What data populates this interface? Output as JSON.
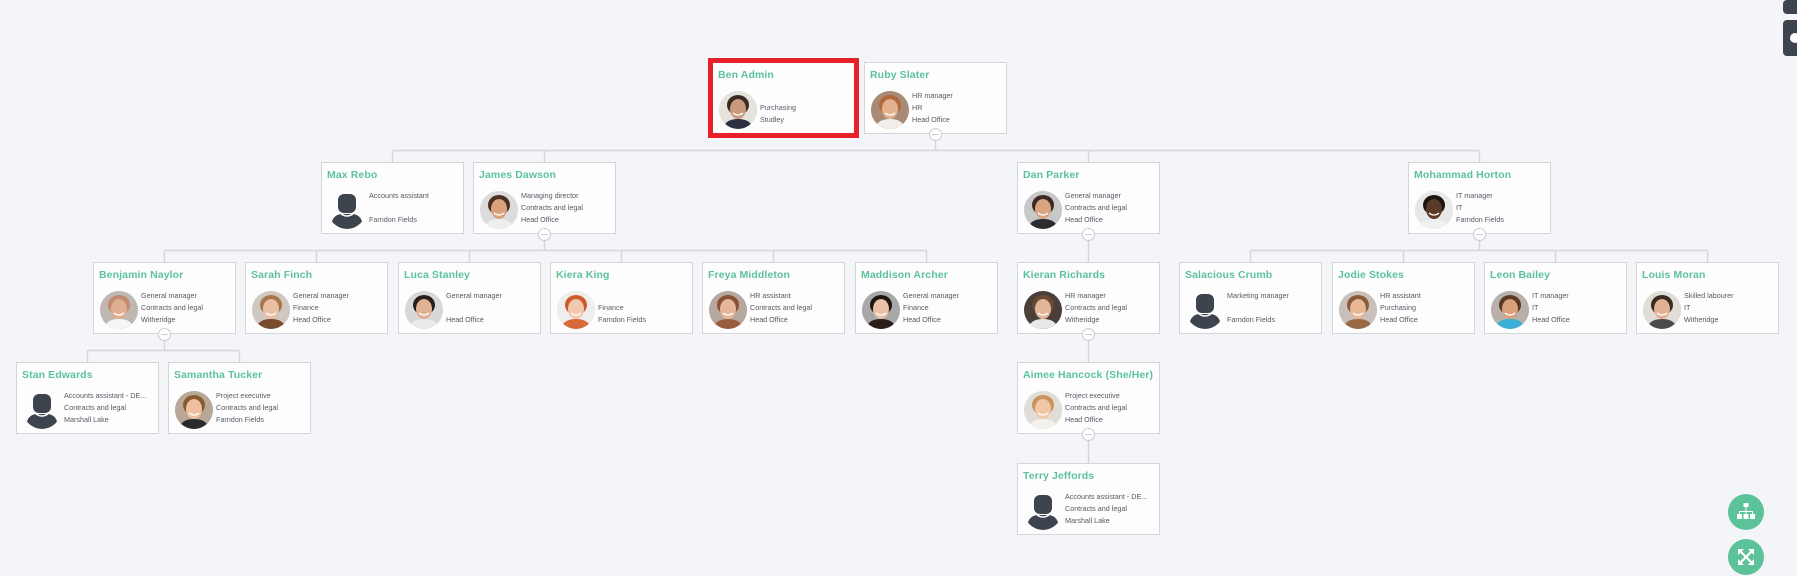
{
  "theme": {
    "accent": "#5cc29a",
    "selection": "#e8202a",
    "background": "#f4f5f9",
    "dark_tab": "#3e444d"
  },
  "nodes": [
    {
      "id": "ben",
      "name": "Ben Admin",
      "lines": [
        "",
        "Purchasing",
        "Studley"
      ],
      "avatar": "photo-bearded-man",
      "selected": true,
      "row": 0
    },
    {
      "id": "ruby",
      "name": "Ruby Slater",
      "lines": [
        "HR manager",
        "HR",
        "Head Office"
      ],
      "avatar": "photo-woman-smiling",
      "row": 0,
      "toggle": true
    },
    {
      "id": "max",
      "name": "Max Rebo",
      "lines": [
        "Accounts assistant",
        "",
        "Farndon Fields"
      ],
      "avatar": "silhouette",
      "row": 1
    },
    {
      "id": "james",
      "name": "James Dawson",
      "lines": [
        "Managing director",
        "Contracts and legal",
        "Head Office"
      ],
      "avatar": "photo-man-smiling",
      "row": 1,
      "toggle": true
    },
    {
      "id": "dan",
      "name": "Dan Parker",
      "lines": [
        "General manager",
        "Contracts and legal",
        "Head Office"
      ],
      "avatar": "photo-man-suit",
      "row": 1,
      "toggle": true
    },
    {
      "id": "mohammad",
      "name": "Mohammad Horton",
      "lines": [
        "IT manager",
        "IT",
        "Farndon Fields"
      ],
      "avatar": "photo-man-glasses",
      "row": 1,
      "toggle": true
    },
    {
      "id": "benjamin",
      "name": "Benjamin Naylor",
      "lines": [
        "General manager",
        "Contracts and legal",
        "Witheridge"
      ],
      "avatar": "photo-bald-man",
      "row": 2,
      "toggle": true
    },
    {
      "id": "sarah",
      "name": "Sarah Finch",
      "lines": [
        "General manager",
        "Finance",
        "Head Office"
      ],
      "avatar": "photo-woman-glasses",
      "row": 2
    },
    {
      "id": "luca",
      "name": "Luca Stanley",
      "lines": [
        "General manager",
        "",
        "Head Office"
      ],
      "avatar": "photo-man-curly",
      "row": 2
    },
    {
      "id": "kiera",
      "name": "Kiera King",
      "lines": [
        "",
        "Finance",
        "Farndon Fields"
      ],
      "avatar": "photo-woman-redhead",
      "row": 2
    },
    {
      "id": "freya",
      "name": "Freya Middleton",
      "lines": [
        "HR assistant",
        "Contracts and legal",
        "Head Office"
      ],
      "avatar": "photo-woman-wavy",
      "row": 2
    },
    {
      "id": "maddison",
      "name": "Maddison Archer",
      "lines": [
        "General manager",
        "Finance",
        "Head Office"
      ],
      "avatar": "photo-woman-dark-hair",
      "row": 2
    },
    {
      "id": "kieran",
      "name": "Kieran Richards",
      "lines": [
        "HR manager",
        "Contracts and legal",
        "Witheridge"
      ],
      "avatar": "photo-man-tie",
      "row": 2,
      "toggle": true
    },
    {
      "id": "salacious",
      "name": "Salacious Crumb",
      "lines": [
        "Marketing manager",
        "",
        "Farndon Fields"
      ],
      "avatar": "silhouette",
      "row": 2
    },
    {
      "id": "jodie",
      "name": "Jodie Stokes",
      "lines": [
        "HR assistant",
        "Purchasing",
        "Head Office"
      ],
      "avatar": "photo-woman-long-hair",
      "row": 2
    },
    {
      "id": "leon",
      "name": "Leon Bailey",
      "lines": [
        "IT manager",
        "IT",
        "Head Office"
      ],
      "avatar": "photo-man-blue-shirt",
      "row": 2
    },
    {
      "id": "louis",
      "name": "Louis Moran",
      "lines": [
        "Skilled labourer",
        "IT",
        "Witheridge"
      ],
      "avatar": "photo-man-grin",
      "row": 2
    },
    {
      "id": "stan",
      "name": "Stan Edwards",
      "lines": [
        "Accounts assistant - DE...",
        "Contracts and legal",
        "Marshall Lake"
      ],
      "avatar": "silhouette",
      "row": 3
    },
    {
      "id": "samantha",
      "name": "Samantha Tucker",
      "lines": [
        "Project executive",
        "Contracts and legal",
        "Farndon Fields"
      ],
      "avatar": "photo-woman-curly",
      "row": 3
    },
    {
      "id": "aimee",
      "name": "Aimee Hancock (She/Her)",
      "lines": [
        "Project executive",
        "Contracts and legal",
        "Head Office"
      ],
      "avatar": "photo-woman-blonde",
      "row": 3,
      "toggle": true
    },
    {
      "id": "terry",
      "name": "Terry Jeffords",
      "lines": [
        "Accounts assistant - DE...",
        "Contracts and legal",
        "Marshall Lake"
      ],
      "avatar": "silhouette",
      "row": 4
    }
  ],
  "edges": [
    {
      "from": "ruby",
      "to": [
        "max",
        "james",
        "dan",
        "mohammad"
      ]
    },
    {
      "from": "james",
      "to": [
        "benjamin",
        "sarah",
        "luca",
        "kiera",
        "freya",
        "maddison"
      ]
    },
    {
      "from": "dan",
      "to": [
        "kieran"
      ]
    },
    {
      "from": "mohammad",
      "to": [
        "salacious",
        "jodie",
        "leon",
        "louis"
      ]
    },
    {
      "from": "benjamin",
      "to": [
        "stan",
        "samantha"
      ]
    },
    {
      "from": "kieran",
      "to": [
        "aimee"
      ]
    },
    {
      "from": "aimee",
      "to": [
        "terry"
      ]
    }
  ],
  "controls": {
    "layout_button_icon": "org-chart-icon",
    "fit_button_icon": "expand-arrows-icon",
    "side_tab_icons": [
      "panel-tab-icon",
      "panel-tab-icon"
    ]
  }
}
